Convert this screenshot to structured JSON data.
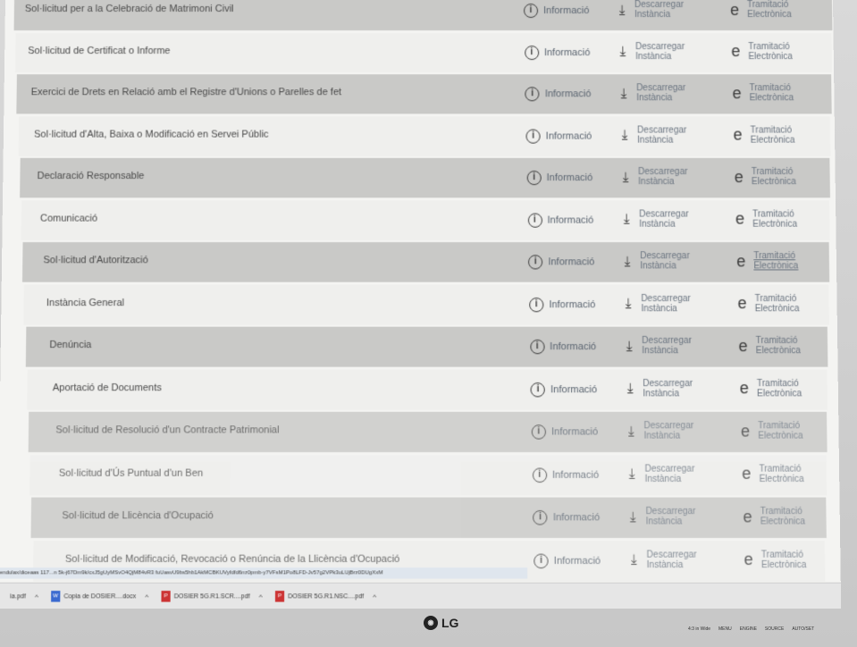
{
  "rows": [
    {
      "title": "Sol·licitud per a la Celebració de Matrimoni Civil",
      "shade": "dark"
    },
    {
      "title": "Sol·licitud de Certificat o Informe",
      "shade": "light"
    },
    {
      "title": "Exercici de Drets en Relació amb el Registre d'Unions o Parelles de fet",
      "shade": "dark"
    },
    {
      "title": "Sol·licitud d'Alta, Baixa o Modificació en Servei Públic",
      "shade": "light"
    },
    {
      "title": "Declaració Responsable",
      "shade": "dark"
    },
    {
      "title": "Comunicació",
      "shade": "light"
    },
    {
      "title": "Sol·licitud d'Autorització",
      "shade": "dark"
    },
    {
      "title": "Instància General",
      "shade": "light"
    },
    {
      "title": "Denúncia",
      "shade": "dark"
    },
    {
      "title": "Aportació de Documents",
      "shade": "light"
    },
    {
      "title": "Sol·licitud de Resolució d'un Contracte Patrimonial",
      "shade": "dark"
    },
    {
      "title": "Sol·licitud d'Ús Puntual d'un Ben",
      "shade": "light"
    },
    {
      "title": "Sol·licitud de Llicència d'Ocupació",
      "shade": "dark"
    },
    {
      "title": "Sol·licitud de Modificació, Revocació o Renúncia de la Llicència d'Ocupació",
      "shade": "light"
    }
  ],
  "actions": {
    "info": "Informació",
    "download_line1": "Descarregar",
    "download_line2": "Instància",
    "tramit_line1": "Tramitació",
    "tramit_line2": "Electrònica"
  },
  "statusbar": {
    "url": "endulax/diceaas 117...n 5k-j67Dm9k/cxJ5gUyMSvO4QjM84vR3 fuUasvU9bs5hb1AkMCBKUVyfdfd6nz0pmb-y7VFsM1Po8LFD-Jv57g2VPk3uLUjBrz0DUgXxM"
  },
  "downloads": [
    {
      "label": "ia.pdf",
      "type": "pdf"
    },
    {
      "label": "Copia de DOSIER....docx",
      "type": "docx"
    },
    {
      "label": "DOSIER 5G.R1.SCR....pdf",
      "type": "pdf"
    },
    {
      "label": "DOSIER 5G.R1.NSC....pdf",
      "type": "pdf"
    }
  ],
  "bezel": {
    "brand": "LG",
    "buttons": [
      "4:3 in Wide",
      "MENU",
      "ENGINE",
      "SOURCE",
      "AUTO/SET"
    ]
  }
}
